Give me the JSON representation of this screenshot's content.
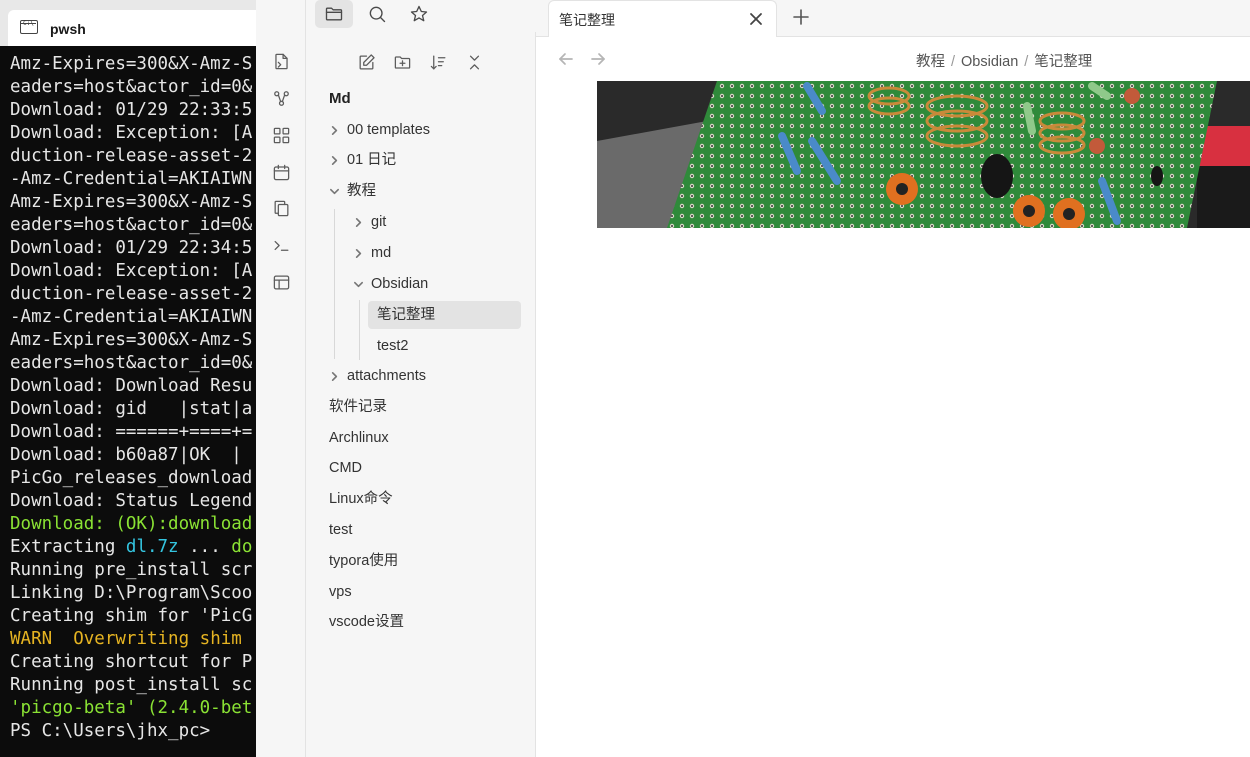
{
  "terminal": {
    "tab_title": "pwsh",
    "tab_icon": "terminal-icon",
    "lines": [
      {
        "text": "Amz-Expires=300&X-Amz-S",
        "color": "default"
      },
      {
        "text": "eaders=host&actor_id=0&",
        "color": "default"
      },
      {
        "text": "Download: 01/29 22:33:5",
        "color": "default"
      },
      {
        "text": "Download: Exception: [A",
        "color": "default"
      },
      {
        "text": "duction-release-asset-2",
        "color": "default"
      },
      {
        "text": "-Amz-Credential=AKIAIWN",
        "color": "default"
      },
      {
        "text": "Amz-Expires=300&X-Amz-S",
        "color": "default"
      },
      {
        "text": "eaders=host&actor_id=0&",
        "color": "default"
      },
      {
        "text": "Download: 01/29 22:34:5",
        "color": "default"
      },
      {
        "text": "Download: Exception: [A",
        "color": "default"
      },
      {
        "text": "duction-release-asset-2",
        "color": "default"
      },
      {
        "text": "-Amz-Credential=AKIAIWN",
        "color": "default"
      },
      {
        "text": "Amz-Expires=300&X-Amz-S",
        "color": "default"
      },
      {
        "text": "eaders=host&actor_id=0&",
        "color": "default"
      },
      {
        "text": "Download: Download Resu",
        "color": "default"
      },
      {
        "text": "Download: gid   |stat|a",
        "color": "default"
      },
      {
        "text": "Download: ======+====+=",
        "color": "default"
      },
      {
        "text": "Download: b60a87|OK  |",
        "color": "default"
      },
      {
        "text": "PicGo_releases_download",
        "color": "default"
      },
      {
        "text": "Download: Status Legend",
        "color": "default"
      },
      {
        "text": "Download: (OK):download",
        "color": "green"
      }
    ],
    "extract_line": {
      "prefix": "Extracting ",
      "file": "dl.7z",
      "middle": " ... ",
      "tail": "do"
    },
    "lines2": [
      {
        "text": "Running pre_install scr",
        "color": "default"
      },
      {
        "text": "Linking D:\\Program\\Scoo",
        "color": "default"
      },
      {
        "text": "Creating shim for 'PicG",
        "color": "default"
      }
    ],
    "warn_line": {
      "tag": "WARN",
      "text": "  Overwriting shim "
    },
    "lines3": [
      {
        "text": "Creating shortcut for P",
        "color": "default"
      },
      {
        "text": "Running post_install sc",
        "color": "default"
      },
      {
        "text": "'picgo-beta' (2.4.0-bet",
        "color": "green"
      },
      {
        "text": "PS C:\\Users\\jhx_pc>",
        "color": "default"
      }
    ]
  },
  "ribbon": {
    "icons": [
      "open-quick-switcher-icon",
      "graph-view-icon",
      "canvas-icon",
      "daily-notes-icon",
      "templates-icon",
      "command-palette-icon",
      "workspace-layout-icon"
    ]
  },
  "top_icons": [
    "sidebar-toggle-icon",
    "files-icon",
    "search-icon",
    "bookmarks-icon"
  ],
  "explorer": {
    "tools": [
      "new-note-icon",
      "new-folder-icon",
      "sort-icon",
      "collapse-all-icon"
    ],
    "vault_name": "Md",
    "items": {
      "templates": "00 templates",
      "diary": "01 日记",
      "tutorial": "教程",
      "git": "git",
      "md": "md",
      "obsidian": "Obsidian",
      "notes": "笔记整理",
      "test2": "test2",
      "attachments": "attachments",
      "software": "软件记录",
      "archlinux": "Archlinux",
      "cmd": "CMD",
      "linux": "Linux命令",
      "test": "test",
      "typora": "typora使用",
      "vps": "vps",
      "vscode": "vscode设置"
    }
  },
  "tabs": {
    "active_title": "笔记整理",
    "close_icon": "close-icon",
    "new_tab_icon": "plus-icon"
  },
  "content": {
    "breadcrumb": [
      "教程",
      "Obsidian",
      "笔记整理"
    ],
    "separator": "/",
    "image_description_colors": {
      "board": "#2e8b3d",
      "coil": "#b5652a",
      "ferrite": "#e07020"
    }
  }
}
